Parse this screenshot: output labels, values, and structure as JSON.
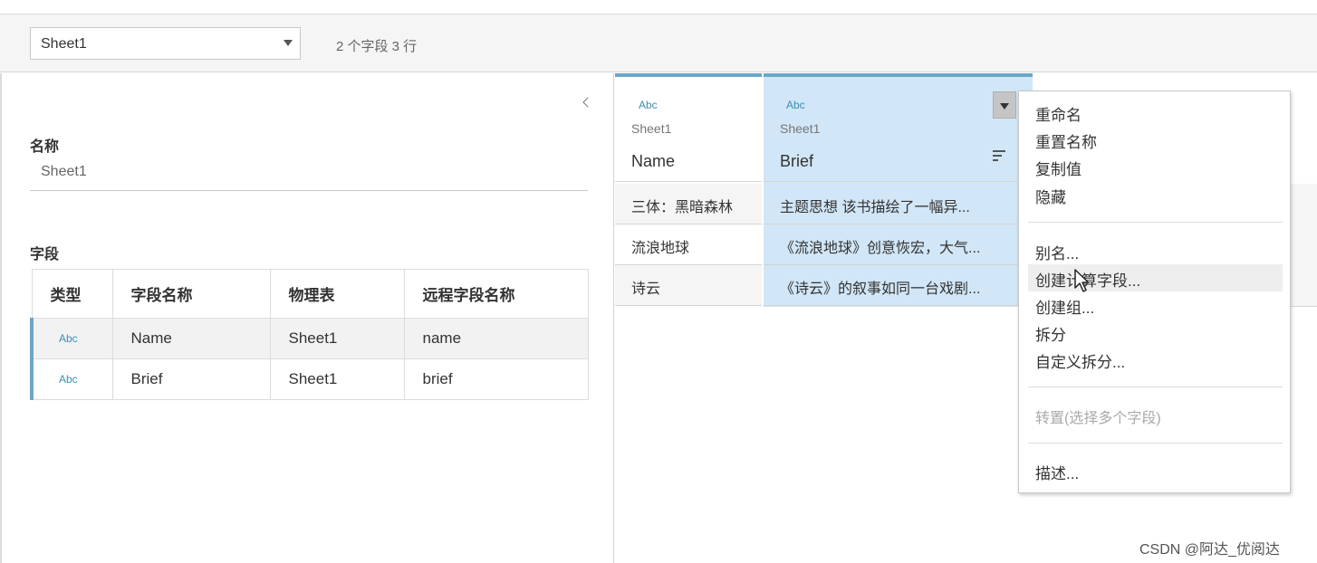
{
  "toolbar": {
    "sheet_select": "Sheet1",
    "field_count": "2 个字段 3 行"
  },
  "left_panel": {
    "name_label": "名称",
    "name_value": "Sheet1",
    "fields_label": "字段",
    "table": {
      "headers": [
        "类型",
        "字段名称",
        "物理表",
        "远程字段名称"
      ],
      "rows": [
        {
          "type": "Abc",
          "field": "Name",
          "table": "Sheet1",
          "remote": "name"
        },
        {
          "type": "Abc",
          "field": "Brief",
          "table": "Sheet1",
          "remote": "brief"
        }
      ]
    }
  },
  "grid": {
    "columns": [
      {
        "type": "Abc",
        "table": "Sheet1",
        "name": "Name",
        "cells": [
          "三体：黑暗森林",
          "流浪地球",
          "诗云"
        ]
      },
      {
        "type": "Abc",
        "table": "Sheet1",
        "name": "Brief",
        "cells": [
          "主题思想   该书描绘了一幅异...",
          "《流浪地球》创意恢宏，大气...",
          "《诗云》的叙事如同一台戏剧..."
        ]
      }
    ]
  },
  "context_menu": {
    "items": [
      "重命名",
      "重置名称",
      "复制值",
      "隐藏",
      "别名...",
      "创建计算字段...",
      "创建组...",
      "拆分",
      "自定义拆分...",
      "转置(选择多个字段)",
      "描述..."
    ]
  },
  "watermark": "CSDN @阿达_优阅达",
  "colors": {
    "accent": "#6aa7c8",
    "selected_column": "#d1e6f6",
    "type_icon": "#3a8fb7"
  }
}
